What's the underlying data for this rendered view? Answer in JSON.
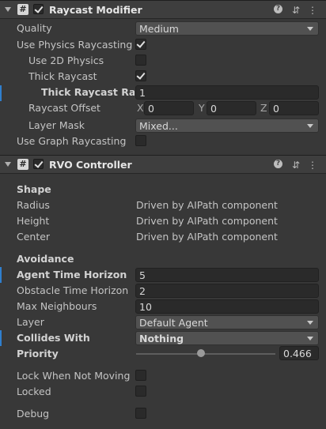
{
  "raycast": {
    "title": "Raycast Modifier",
    "rows": {
      "quality": {
        "label": "Quality",
        "value": "Medium"
      },
      "use_physics": {
        "label": "Use Physics Raycasting",
        "checked": true
      },
      "use_2d": {
        "label": "Use 2D Physics",
        "checked": false
      },
      "thick": {
        "label": "Thick Raycast",
        "checked": true
      },
      "thick_radius": {
        "label": "Thick Raycast Radius",
        "value": "1"
      },
      "offset": {
        "label": "Raycast Offset",
        "x_label": "X",
        "x": "0",
        "y_label": "Y",
        "y": "0",
        "z_label": "Z",
        "z": "0"
      },
      "layer_mask": {
        "label": "Layer Mask",
        "value": "Mixed..."
      },
      "use_graph": {
        "label": "Use Graph Raycasting",
        "checked": false
      }
    }
  },
  "rvo": {
    "title": "RVO Controller",
    "shape": {
      "heading": "Shape",
      "radius": {
        "label": "Radius",
        "value": "Driven by AIPath component"
      },
      "height": {
        "label": "Height",
        "value": "Driven by AIPath component"
      },
      "center": {
        "label": "Center",
        "value": "Driven by AIPath component"
      }
    },
    "avoidance": {
      "heading": "Avoidance",
      "agent_time": {
        "label": "Agent Time Horizon",
        "value": "5"
      },
      "obstacle_time": {
        "label": "Obstacle Time Horizon",
        "value": "2"
      },
      "max_neighbours": {
        "label": "Max Neighbours",
        "value": "10"
      },
      "layer": {
        "label": "Layer",
        "value": "Default Agent"
      },
      "collides_with": {
        "label": "Collides With",
        "value": "Nothing"
      },
      "priority": {
        "label": "Priority",
        "value": "0.466",
        "fraction": 0.466
      }
    },
    "lock_when_not_moving": {
      "label": "Lock When Not Moving",
      "checked": false
    },
    "locked": {
      "label": "Locked",
      "checked": false
    },
    "debug": {
      "label": "Debug",
      "checked": false
    }
  },
  "icons": {
    "script": "#",
    "help": "?",
    "settings": "⇵",
    "menu": "⋮"
  },
  "colors": {
    "background": "#383838",
    "header": "#3e3e3e",
    "field": "#2a2a2a",
    "dropdown": "#515151",
    "modified_marker": "#2f7fce"
  }
}
